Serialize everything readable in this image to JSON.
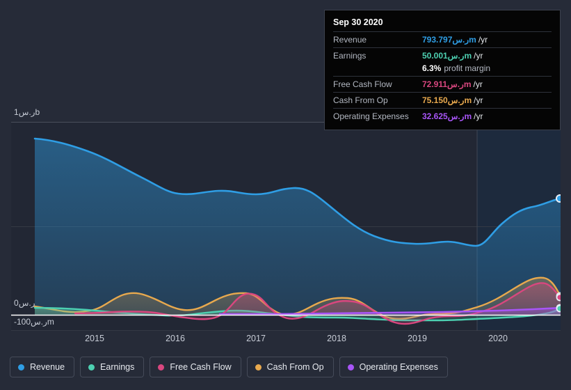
{
  "theme": {
    "background": "#262b38",
    "plot_background": "#222734",
    "forecast_background": "#1d2a3d",
    "gridline": "#3a3f4b",
    "zeroline": "#ffffff",
    "axis_text": "#c7ccd6"
  },
  "tooltip": {
    "date": "Sep 30 2020",
    "rows": [
      {
        "label": "Revenue",
        "value": "793.797ر.سm",
        "unit": "/yr",
        "color": "#2f9ee5"
      },
      {
        "label": "Earnings",
        "value": "50.001ر.سm",
        "unit": "/yr",
        "color": "#4dd0b1"
      },
      {
        "label": "Free Cash Flow",
        "value": "72.911ر.سm",
        "unit": "/yr",
        "color": "#d9477f"
      },
      {
        "label": "Cash From Op",
        "value": "75.150ر.سm",
        "unit": "/yr",
        "color": "#e8a94e"
      },
      {
        "label": "Operating Expenses",
        "value": "32.625ر.سm",
        "unit": "/yr",
        "color": "#a855f7"
      }
    ],
    "margin_value": "6.3%",
    "margin_text": "profit margin"
  },
  "legend": {
    "items": [
      {
        "label": "Revenue",
        "color": "#2f9ee5"
      },
      {
        "label": "Earnings",
        "color": "#4dd0b1"
      },
      {
        "label": "Free Cash Flow",
        "color": "#d9477f"
      },
      {
        "label": "Cash From Op",
        "color": "#e8a94e"
      },
      {
        "label": "Operating Expenses",
        "color": "#a855f7"
      }
    ]
  },
  "chart_data": {
    "type": "area",
    "title": "",
    "xlabel": "",
    "ylabel": "",
    "currency": "ر.س",
    "grid": true,
    "legend_position": "bottom",
    "ylim": [
      -100,
      1000
    ],
    "yticks": [
      {
        "value": 1000,
        "label": "1ر.سb"
      },
      {
        "value": 0,
        "label": "0ر.س"
      },
      {
        "value": -100,
        "label": "-100ر.سm"
      }
    ],
    "xlim": [
      "2014-07",
      "2021-01"
    ],
    "xticks": [
      "2015",
      "2016",
      "2017",
      "2018",
      "2019",
      "2020"
    ],
    "forecast_divider_x": "2019-11",
    "x": [
      "2014-09",
      "2014-12",
      "2015-03",
      "2015-06",
      "2015-09",
      "2015-12",
      "2016-03",
      "2016-06",
      "2016-09",
      "2016-12",
      "2017-03",
      "2017-06",
      "2017-09",
      "2017-12",
      "2018-03",
      "2018-06",
      "2018-09",
      "2018-12",
      "2019-03",
      "2019-06",
      "2019-09",
      "2019-12",
      "2020-03",
      "2020-06",
      "2020-09"
    ],
    "series": [
      {
        "name": "Revenue",
        "color": "#2f9ee5",
        "values": [
          920,
          910,
          880,
          840,
          795,
          760,
          735,
          742,
          733,
          720,
          730,
          735,
          700,
          640,
          590,
          545,
          528,
          525,
          534,
          530,
          515,
          528,
          543,
          580,
          794
        ]
      },
      {
        "name": "Earnings",
        "color": "#4dd0b1",
        "values": [
          38,
          40,
          41,
          39,
          33,
          28,
          22,
          21,
          25,
          30,
          33,
          32,
          28,
          25,
          23,
          21,
          18,
          14,
          8,
          5,
          3,
          2,
          6,
          20,
          50
        ]
      },
      {
        "name": "Free Cash Flow",
        "color": "#d9477f",
        "values": [
          null,
          null,
          8,
          9,
          11,
          14,
          15,
          11,
          4,
          2,
          5,
          48,
          34,
          2,
          30,
          52,
          54,
          40,
          4,
          -14,
          -10,
          -18,
          2,
          8,
          73
        ]
      },
      {
        "name": "Cash From Op",
        "color": "#e8a94e",
        "values": [
          44,
          38,
          30,
          27,
          32,
          54,
          60,
          40,
          31,
          45,
          62,
          70,
          62,
          30,
          44,
          60,
          61,
          52,
          28,
          -2,
          2,
          -4,
          10,
          44,
          75
        ]
      },
      {
        "name": "Operating Expenses",
        "color": "#a855f7",
        "values": [
          null,
          null,
          null,
          null,
          null,
          null,
          null,
          null,
          null,
          6,
          6,
          6,
          6,
          6,
          7,
          8,
          9,
          10,
          11,
          12,
          13,
          14,
          16,
          22,
          33
        ]
      }
    ]
  }
}
